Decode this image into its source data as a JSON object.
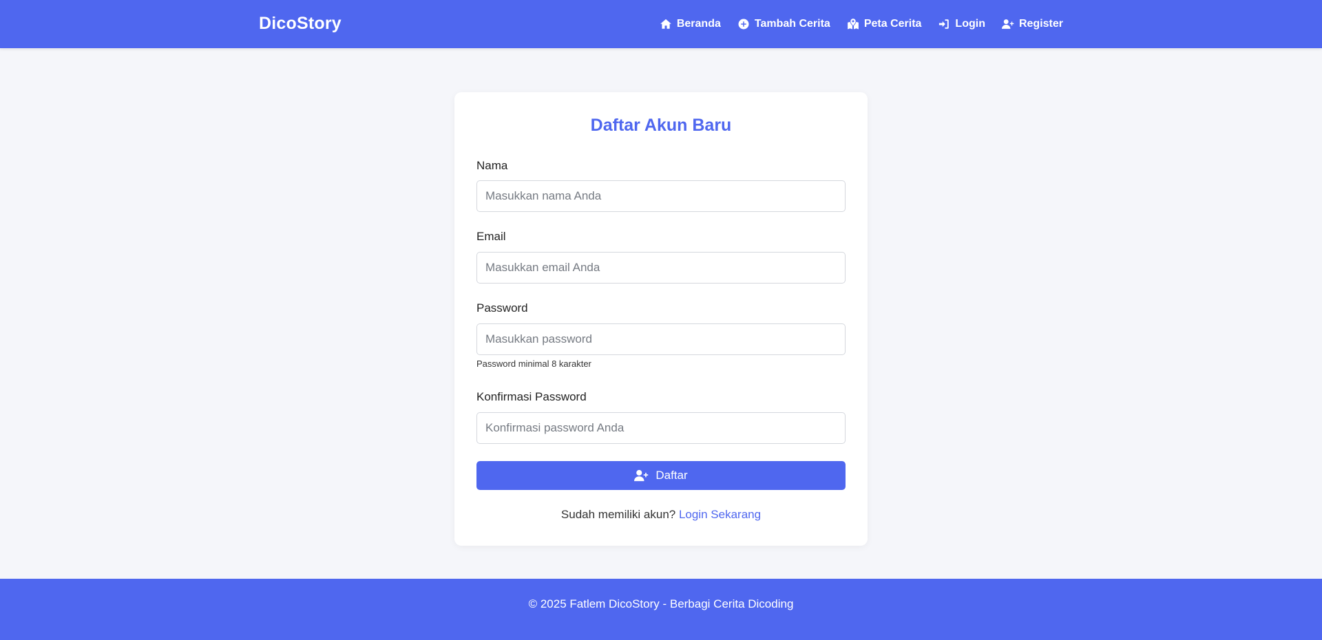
{
  "header": {
    "brand": "DicoStory",
    "nav": [
      {
        "label": "Beranda",
        "icon": "home-icon"
      },
      {
        "label": "Tambah Cerita",
        "icon": "plus-circle-icon"
      },
      {
        "label": "Peta Cerita",
        "icon": "map-icon"
      },
      {
        "label": "Login",
        "icon": "sign-in-icon"
      },
      {
        "label": "Register",
        "icon": "user-plus-icon"
      }
    ]
  },
  "form": {
    "title": "Daftar Akun Baru",
    "name": {
      "label": "Nama",
      "placeholder": "Masukkan nama Anda",
      "value": ""
    },
    "email": {
      "label": "Email",
      "placeholder": "Masukkan email Anda",
      "value": ""
    },
    "password": {
      "label": "Password",
      "placeholder": "Masukkan password",
      "value": "",
      "hint": "Password minimal 8 karakter"
    },
    "confirm": {
      "label": "Konfirmasi Password",
      "placeholder": "Konfirmasi password Anda",
      "value": ""
    },
    "submit_label": "Daftar",
    "submit_icon": "user-plus-icon",
    "login_prompt": "Sudah memiliki akun?",
    "login_link": "Login Sekarang"
  },
  "footer": {
    "text": "© 2025 Fatlem DicoStory - Berbagi Cerita Dicoding"
  },
  "colors": {
    "primary": "#4f67ef",
    "background": "#f5f6fa",
    "card": "#ffffff"
  }
}
